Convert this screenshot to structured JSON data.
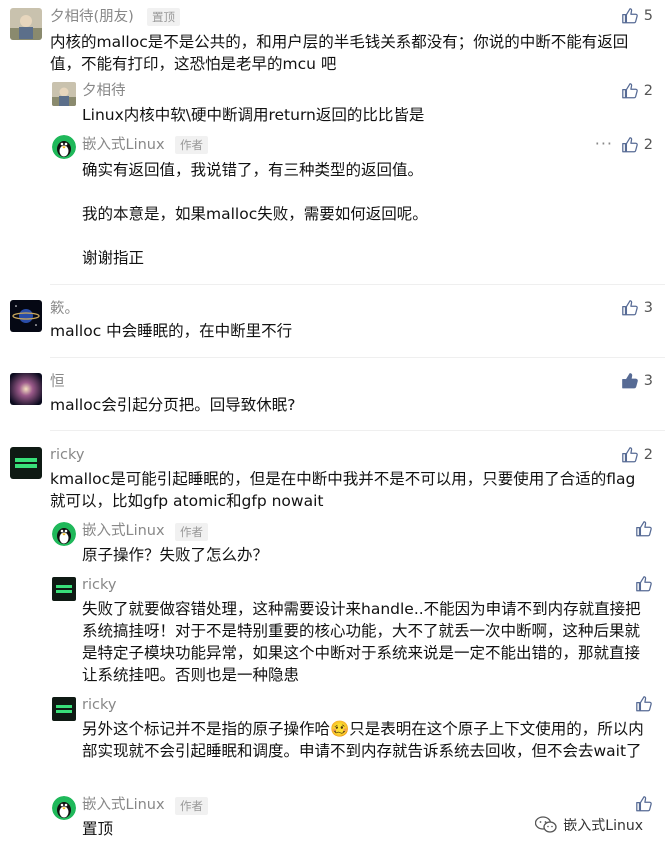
{
  "comments": [
    {
      "name": "夕相待(朋友)",
      "tag": "置顶",
      "likes": "5",
      "text": "内核的malloc是不是公共的，和用户层的半毛钱关系都没有；你说的中断不能有返回值，不能有打印，这恐怕是老早的mcu 吧",
      "replies": [
        {
          "name": "夕相待",
          "likes": "2",
          "text": "Linux内核中软\\硬中断调用return返回的比比皆是"
        },
        {
          "name": "嵌入式Linux",
          "tag": "作者",
          "likes": "2",
          "more": "···",
          "text": "确实有返回值，我说错了，有三种类型的返回值。\n\n我的本意是，如果malloc失败，需要如何返回呢。\n\n谢谢指正"
        }
      ]
    },
    {
      "name": "簌。",
      "likes": "3",
      "text": "malloc 中会睡眠的，在中断里不行"
    },
    {
      "name": "恒",
      "likes": "3",
      "text": "malloc会引起分页把。回导致休眠?"
    },
    {
      "name": "ricky",
      "likes": "2",
      "text": "kmalloc是可能引起睡眠的，但是在中断中我并不是不可以用，只要使用了合适的flag就可以，比如gfp atomic和gfp nowait",
      "replies": [
        {
          "name": "嵌入式Linux",
          "tag": "作者",
          "text": "原子操作？失败了怎么办？"
        },
        {
          "name": "ricky",
          "text": "失败了就要做容错处理，这种需要设计来handle..不能因为申请不到内存就直接把系统搞挂呀！对于不是特别重要的核心功能，大不了就丢一次中断啊，这种后果就是特定子模块功能异常，如果这个中断对于系统来说是一定不能出错的，那就直接让系统挂吧。否则也是一种隐患"
        },
        {
          "name": "ricky",
          "text": "另外这个标记并不是指的原子操作哈🥴只是表明在这个原子上下文使用的，所以内部实现就不会引起睡眠和调度。申请不到内存就告诉系统去回收，但不会去wait了"
        },
        {
          "name": "嵌入式Linux",
          "tag": "作者",
          "text": "置顶"
        }
      ]
    }
  ],
  "watermark": "嵌入式Linux",
  "icons": {
    "like": "thumbs-up-icon",
    "more": "more-dots-icon",
    "wechat": "wechat-logo-icon"
  },
  "colors": {
    "liked": "#576b95",
    "muted": "#888888",
    "tag_bg": "#f1f1f1"
  }
}
